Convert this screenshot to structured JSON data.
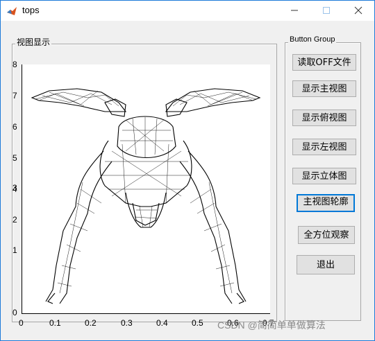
{
  "window": {
    "title": "tops"
  },
  "view_panel": {
    "label": "视图显示"
  },
  "button_group": {
    "label": "Button Group",
    "buttons": [
      "读取OFF文件",
      "显示主视图",
      "显示俯视图",
      "显示左视图",
      "显示立体图",
      "主视图轮廓",
      "全方位观察",
      "退出"
    ]
  },
  "axes": {
    "x_ticks": [
      "0",
      "0.1",
      "0.2",
      "0.3",
      "0.4",
      "0.5",
      "0.6",
      "0.7"
    ],
    "y_ticks": [
      "0",
      "1",
      "2",
      "3",
      "4",
      "5",
      "6",
      "7",
      "8"
    ]
  },
  "watermark": "CSDN @简简单单做算法"
}
